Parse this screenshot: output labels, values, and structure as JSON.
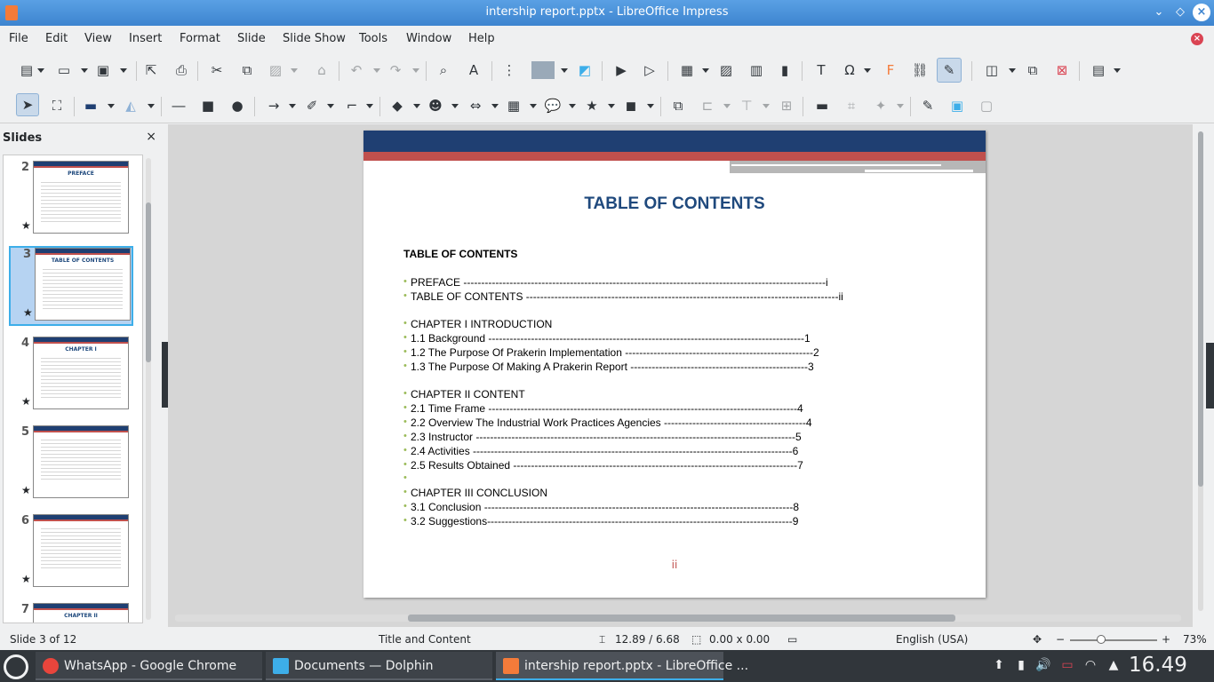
{
  "window": {
    "title": "intership report.pptx - LibreOffice Impress"
  },
  "menu": {
    "items": [
      "File",
      "Edit",
      "View",
      "Insert",
      "Format",
      "Slide",
      "Slide Show",
      "Tools",
      "Window",
      "Help"
    ]
  },
  "slides_panel": {
    "header": "Slides",
    "close_glyph": "×",
    "thumbnails": [
      {
        "num": "2",
        "title": "PREFACE"
      },
      {
        "num": "3",
        "title": "TABLE OF CONTENTS",
        "selected": true
      },
      {
        "num": "4",
        "title": "CHAPTER I"
      },
      {
        "num": "5",
        "title": ""
      },
      {
        "num": "6",
        "title": ""
      },
      {
        "num": "7",
        "title": "CHAPTER II"
      }
    ]
  },
  "slide": {
    "title": "TABLE OF CONTENTS",
    "subtitle": "TABLE OF CONTENTS",
    "page_number": "ii",
    "toc": [
      "PREFACE ------------------------------------------------------------------------------------------------------i",
      "TABLE OF CONTENTS  ----------------------------------------------------------------------------------------ii",
      "",
      "CHAPTER I INTRODUCTION",
      "1.1 Background -----------------------------------------------------------------------------------------1",
      "1.2 The Purpose Of Prakerin Implementation -----------------------------------------------------2",
      "1.3 The Purpose Of Making A Prakerin Report --------------------------------------------------3",
      "",
      "CHAPTER II CONTENT",
      "2.1 Time Frame ---------------------------------------------------------------------------------------4",
      "2.2 Overview The Industrial Work Practices Agencies ----------------------------------------4",
      "2.3 Instructor ------------------------------------------------------------------------------------------5",
      "2.4 Activities ------------------------------------------------------------------------------------------6",
      "2.5 Results Obtained --------------------------------------------------------------------------------7",
      "",
      "CHAPTER III CONCLUSION",
      "3.1 Conclusion ---------------------------------------------------------------------------------------8",
      "3.2 Suggestions--------------------------------------------------------------------------------------9"
    ]
  },
  "statusbar": {
    "slide_info": "Slide 3 of 12",
    "layout": "Title and Content",
    "position": "12.89 / 6.68",
    "size": "0.00 x 0.00",
    "language": "English (USA)",
    "zoom_minus": "−",
    "zoom_plus": "+",
    "zoom": "73%"
  },
  "taskbar": {
    "tasks": [
      {
        "label": "WhatsApp - Google Chrome",
        "color": "#e8453c"
      },
      {
        "label": "Documents — Dolphin",
        "color": "#3daee9"
      },
      {
        "label": "intership report.pptx - LibreOffice ...",
        "color": "#f47b3a",
        "active": true
      }
    ],
    "clock": "16.49"
  },
  "colors": {
    "accent": "#3daee9",
    "slide_title": "#1f497d",
    "slide_band_blue": "#1f3f72",
    "slide_band_red": "#c0504d",
    "bullet": "#9bbb59"
  }
}
